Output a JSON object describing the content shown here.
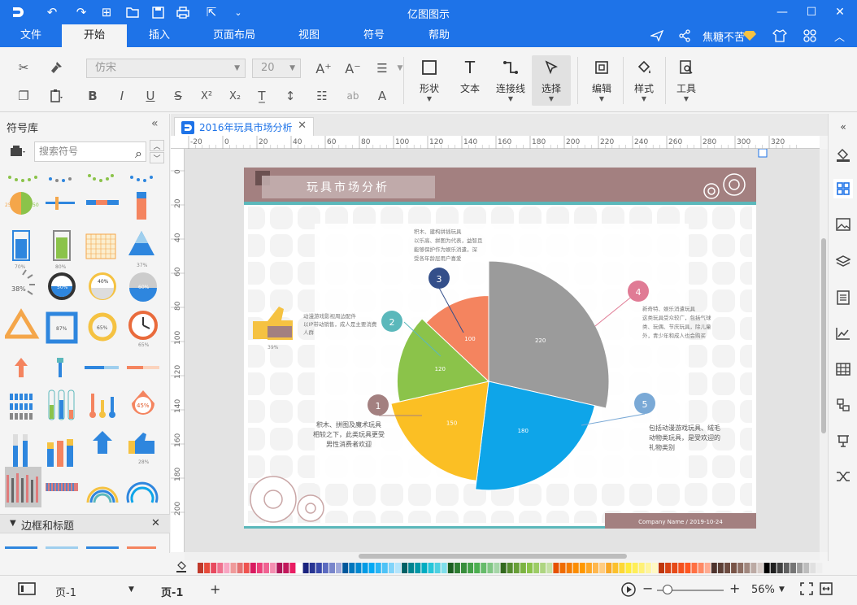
{
  "app": {
    "title": "亿图图示"
  },
  "menu": {
    "tabs": [
      "文件",
      "开始",
      "插入",
      "页面布局",
      "视图",
      "符号",
      "帮助"
    ],
    "active": "开始",
    "user": "焦糖不苦"
  },
  "ribbon": {
    "font_name": "仿宋",
    "font_size": "20",
    "shape": "形状",
    "text": "文本",
    "connector": "连接线",
    "select": "选择",
    "edit": "编辑",
    "style": "样式",
    "tools": "工具"
  },
  "library": {
    "title": "符号库",
    "search_placeholder": "搜索符号",
    "section2": "边框和标题",
    "items": [
      {
        "label": "70%"
      },
      {
        "label": "80%"
      },
      {
        "label": "37%"
      },
      {
        "label": "38%"
      },
      {
        "label": "50%"
      },
      {
        "label": "40%"
      },
      {
        "label": "60%"
      },
      {
        "label": "87%"
      },
      {
        "label": "65%"
      },
      {
        "label": "65%"
      },
      {
        "label": "45%"
      },
      {
        "label": "28%"
      }
    ]
  },
  "document": {
    "tab_title": "2016年玩具市场分析"
  },
  "ruler": {
    "top": [
      "-20",
      "0",
      "20",
      "40",
      "60",
      "80",
      "100",
      "120",
      "140",
      "160",
      "180",
      "200",
      "220",
      "240",
      "260",
      "280",
      "300",
      "320"
    ],
    "left": [
      "0",
      "20",
      "40",
      "60",
      "80",
      "100",
      "120",
      "140",
      "160",
      "180",
      "200"
    ]
  },
  "slide": {
    "title": "玩具市场分析",
    "footer": "Company Name / 2019-10-24",
    "thumb_percent": "39%",
    "annotations": [
      {
        "num": "1",
        "text": [
          "积木、拼图及魔术玩具",
          "相较之下，此类玩具更受",
          "男性消费者欢迎"
        ]
      },
      {
        "num": "2",
        "text": [
          "动漫游戏影视周边配件",
          "以IP带动销售，成人是主要消费",
          "人群"
        ]
      },
      {
        "num": "3",
        "text": [
          "积木、建构拼插玩具",
          "以乐高、拼图为代表，益智且",
          "能够保护作为娱乐消遣，深",
          "受各年龄层用户喜爱"
        ]
      },
      {
        "num": "4",
        "text": [
          "新奇特、娱乐消遣玩具",
          "这类玩具受众较广，包括气球",
          "类、玩偶、节庆玩具，除儿童",
          "外，青少年和成人也会购买"
        ]
      },
      {
        "num": "5",
        "text": [
          "包括动漫游戏玩具、绒毛",
          "动物类玩具，是受欢迎的",
          "礼物类别"
        ]
      }
    ]
  },
  "chart_data": {
    "type": "pie",
    "series": [
      {
        "value": 220,
        "color": "#9b9b9b"
      },
      {
        "value": 180,
        "color": "#0ea5e9"
      },
      {
        "value": 150,
        "color": "#fbbf24"
      },
      {
        "value": 120,
        "color": "#8bc34a"
      },
      {
        "value": 100,
        "color": "#f4845f"
      }
    ]
  },
  "status": {
    "page_select": "页-1",
    "page_tab": "页-1",
    "add": "+",
    "zoom": "56%"
  },
  "colors": {
    "accent": "#1e73e8",
    "header": "#a38080",
    "teal": "#5bb8bb"
  }
}
